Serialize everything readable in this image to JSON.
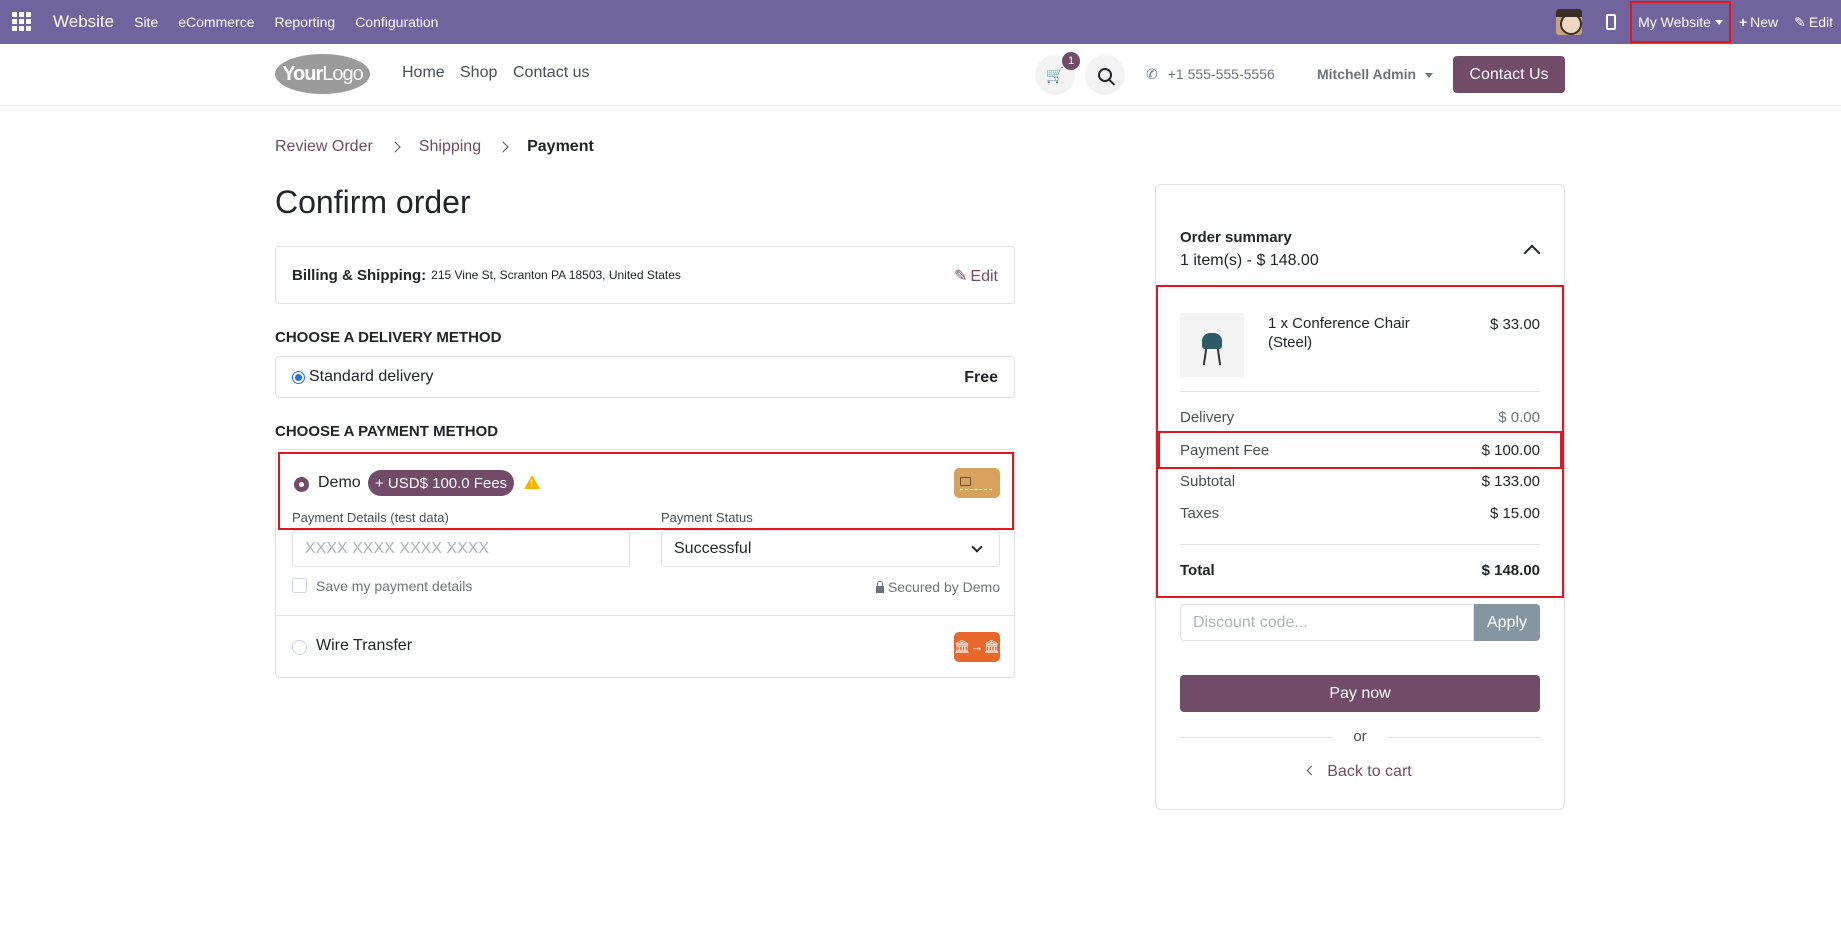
{
  "admin_bar": {
    "app_name": "Website",
    "menus": [
      "Site",
      "eCommerce",
      "Reporting",
      "Configuration"
    ],
    "my_website": "My Website",
    "new_label": "New",
    "edit_label": "Edit"
  },
  "header": {
    "logo_text_bold": "Your",
    "logo_text": "Logo",
    "nav": [
      "Home",
      "Shop",
      "Contact us"
    ],
    "cart_count": "1",
    "phone": "+1 555-555-5556",
    "user": "Mitchell Admin",
    "contact_button": "Contact Us"
  },
  "breadcrumb": {
    "items": [
      "Review Order",
      "Shipping",
      "Payment"
    ]
  },
  "page_title": "Confirm order",
  "billing": {
    "label": "Billing & Shipping:",
    "address": "215 Vine St, Scranton PA 18503, United States",
    "edit_label": "Edit"
  },
  "delivery": {
    "heading": "Choose a delivery method",
    "option_label": "Standard delivery",
    "option_price": "Free"
  },
  "payment": {
    "heading": "Choose a payment method",
    "demo_label": "Demo",
    "fee_badge": "+ USD$ 100.0 Fees",
    "details_label": "Payment Details (test data)",
    "card_placeholder": "XXXX XXXX XXXX XXXX",
    "status_label": "Payment Status",
    "status_value": "Successful",
    "save_label": "Save my payment details",
    "secured_label": "Secured by Demo",
    "wire_label": "Wire Transfer"
  },
  "summary": {
    "title": "Order summary",
    "subtitle": "1 item(s) -  $ 148.00",
    "product_name": "1 x Conference Chair (Steel)",
    "product_price": "$ 33.00",
    "delivery_label": "Delivery",
    "delivery_value": "$ 0.00",
    "fee_label": "Payment Fee",
    "fee_value": "$ 100.00",
    "subtotal_label": "Subtotal",
    "subtotal_value": "$ 133.00",
    "taxes_label": "Taxes",
    "taxes_value": "$ 15.00",
    "total_label": "Total",
    "total_value": "$ 148.00",
    "discount_placeholder": "Discount code...",
    "apply_label": "Apply",
    "pay_label": "Pay now",
    "or_label": "or",
    "back_label": "Back to cart"
  },
  "colors": {
    "admin_bar": "#71639e",
    "brand": "#714b67",
    "highlight": "#e3161d"
  }
}
